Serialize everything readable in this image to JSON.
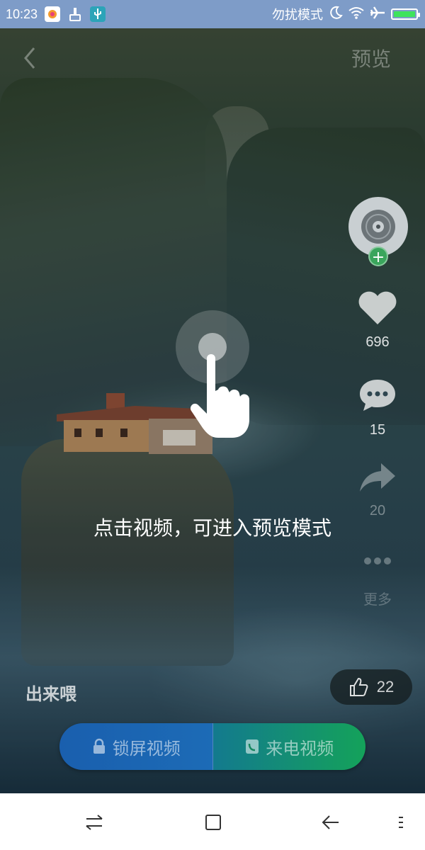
{
  "status_bar": {
    "time": "10:23",
    "dnd_label": "勿扰模式",
    "battery_level": 1.0
  },
  "header": {
    "back_icon": "chevron-left-icon",
    "preview_label": "预览"
  },
  "side_actions": {
    "likes": "696",
    "comments": "15",
    "shares": "20",
    "more_label": "更多"
  },
  "hint": {
    "text": "点击视频，可进入预览模式"
  },
  "video": {
    "author": "出来喂",
    "like_count": "22"
  },
  "actions": {
    "lock_screen_label": "锁屏视频",
    "call_label": "来电视频"
  },
  "colors": {
    "status_bar": "#7e9cc8",
    "lock_button": "#1a5fae",
    "call_button": "#14a25a",
    "follow_button": "#3aa55c",
    "battery_fill": "#3ee35d"
  }
}
